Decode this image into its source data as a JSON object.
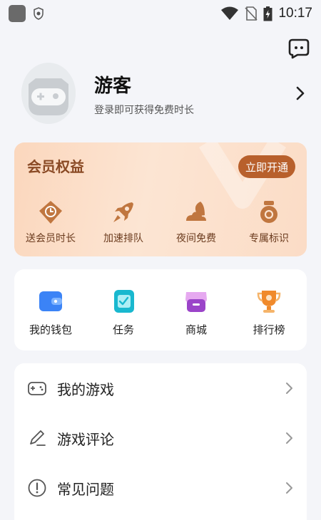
{
  "status_bar": {
    "time": "10:17"
  },
  "profile": {
    "username": "游客",
    "login_hint": "登录即可获得免费时长"
  },
  "vip": {
    "title": "会员权益",
    "open_button": "立即开通",
    "accent_color": "#b8602c",
    "items": [
      {
        "label": "送会员时长",
        "icon": "clock-tag-icon"
      },
      {
        "label": "加速排队",
        "icon": "rocket-icon"
      },
      {
        "label": "夜间免费",
        "icon": "moon-cloud-icon"
      },
      {
        "label": "专属标识",
        "icon": "medal-icon"
      }
    ]
  },
  "quick": {
    "items": [
      {
        "label": "我的钱包",
        "icon": "wallet-icon"
      },
      {
        "label": "任务",
        "icon": "task-icon"
      },
      {
        "label": "商城",
        "icon": "shop-icon"
      },
      {
        "label": "排行榜",
        "icon": "trophy-icon"
      }
    ]
  },
  "menu": {
    "items": [
      {
        "label": "我的游戏",
        "icon": "gamepad-icon"
      },
      {
        "label": "游戏评论",
        "icon": "pencil-icon"
      },
      {
        "label": "常见问题",
        "icon": "info-icon"
      }
    ]
  }
}
